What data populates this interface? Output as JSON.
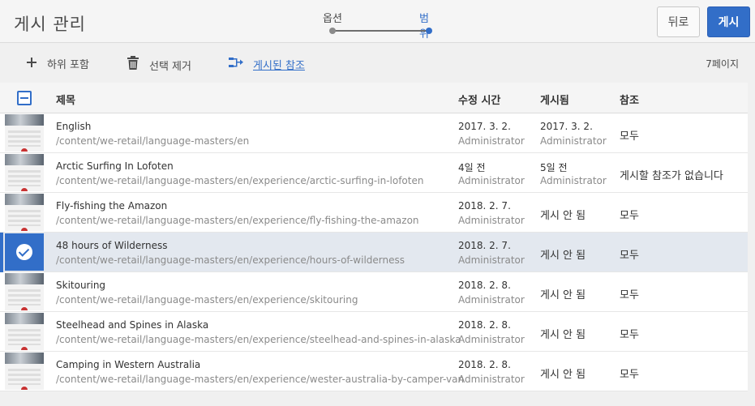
{
  "header": {
    "title": "게시 관리",
    "wizard": {
      "step1": "옵션",
      "step2": "범위"
    },
    "back_label": "뒤로",
    "publish_label": "게시"
  },
  "toolbar": {
    "include_children": "하위 포함",
    "remove_selection": "선택 제거",
    "published_references": "게시된 참조",
    "page_count": "7페이지"
  },
  "table": {
    "headers": {
      "title": "제목",
      "modified": "수정 시간",
      "published": "게시됨",
      "references": "참조"
    },
    "rows": [
      {
        "title": "English",
        "path": "/content/we-retail/language-masters/en",
        "modified": "2017. 3. 2.",
        "modified_by": "Administrator",
        "published": "2017. 3. 2.",
        "published_by": "Administrator",
        "references": "모두",
        "selected": false
      },
      {
        "title": "Arctic Surfing In Lofoten",
        "path": "/content/we-retail/language-masters/en/experience/arctic-surfing-in-lofoten",
        "modified": "4일 전",
        "modified_by": "Administrator",
        "published": "5일 전",
        "published_by": "Administrator",
        "references": "게시할 참조가 없습니다",
        "selected": false
      },
      {
        "title": "Fly-fishing the Amazon",
        "path": "/content/we-retail/language-masters/en/experience/fly-fishing-the-amazon",
        "modified": "2018. 2. 7.",
        "modified_by": "Administrator",
        "published": "게시 안 됨",
        "published_by": "",
        "references": "모두",
        "selected": false
      },
      {
        "title": "48 hours of Wilderness",
        "path": "/content/we-retail/language-masters/en/experience/hours-of-wilderness",
        "modified": "2018. 2. 7.",
        "modified_by": "Administrator",
        "published": "게시 안 됨",
        "published_by": "",
        "references": "모두",
        "selected": true
      },
      {
        "title": "Skitouring",
        "path": "/content/we-retail/language-masters/en/experience/skitouring",
        "modified": "2018. 2. 8.",
        "modified_by": "Administrator",
        "published": "게시 안 됨",
        "published_by": "",
        "references": "모두",
        "selected": false
      },
      {
        "title": "Steelhead and Spines in Alaska",
        "path": "/content/we-retail/language-masters/en/experience/steelhead-and-spines-in-alaska",
        "modified": "2018. 2. 8.",
        "modified_by": "Administrator",
        "published": "게시 안 됨",
        "published_by": "",
        "references": "모두",
        "selected": false
      },
      {
        "title": "Camping in Western Australia",
        "path": "/content/we-retail/language-masters/en/experience/wester-australia-by-camper-van",
        "modified": "2018. 2. 8.",
        "modified_by": "Administrator",
        "published": "게시 안 됨",
        "published_by": "",
        "references": "모두",
        "selected": false
      }
    ]
  },
  "icons": {
    "include_children": "plus-icon",
    "remove_selection": "trash-icon",
    "published_references": "references-tree-icon",
    "selected_row": "check-circle-icon"
  },
  "colors": {
    "accent": "#326ec8",
    "header_bg": "#f5f5f5",
    "selected_row_bg": "#e3e8ef"
  }
}
